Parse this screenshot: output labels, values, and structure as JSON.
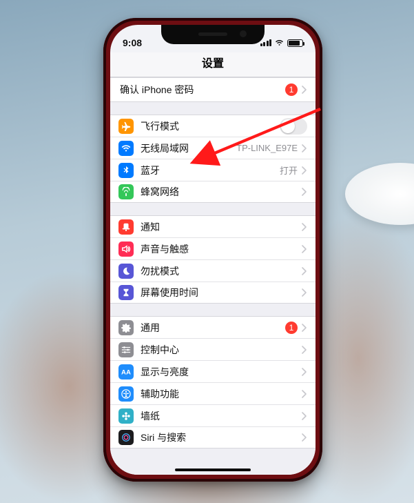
{
  "status": {
    "time": "9:08"
  },
  "title": "设置",
  "groups": [
    {
      "id": "account",
      "cells": [
        {
          "id": "confirm-password",
          "label": "确认 iPhone 密码",
          "badge": "1",
          "chevron": true,
          "icon": null
        }
      ]
    },
    {
      "id": "network",
      "cells": [
        {
          "id": "airplane",
          "label": "飞行模式",
          "icon": "airplane-icon",
          "bg": "bg-orange",
          "toggle": false
        },
        {
          "id": "wifi",
          "label": "无线局域网",
          "value": "TP-LINK_E97E",
          "icon": "wifi-icon",
          "bg": "bg-blue",
          "chevron": true
        },
        {
          "id": "bluetooth",
          "label": "蓝牙",
          "value": "打开",
          "icon": "bluetooth-icon",
          "bg": "bg-blue",
          "chevron": true
        },
        {
          "id": "cellular",
          "label": "蜂窝网络",
          "icon": "cellular-icon",
          "bg": "bg-green",
          "chevron": true
        }
      ]
    },
    {
      "id": "alerts",
      "cells": [
        {
          "id": "notifications",
          "label": "通知",
          "icon": "bell-icon",
          "bg": "bg-red",
          "chevron": true
        },
        {
          "id": "sounds",
          "label": "声音与触感",
          "icon": "speaker-icon",
          "bg": "bg-pink",
          "chevron": true
        },
        {
          "id": "dnd",
          "label": "勿扰模式",
          "icon": "moon-icon",
          "bg": "bg-purple",
          "chevron": true
        },
        {
          "id": "screentime",
          "label": "屏幕使用时间",
          "icon": "hourglass-icon",
          "bg": "bg-purple",
          "chevron": true
        }
      ]
    },
    {
      "id": "general",
      "cells": [
        {
          "id": "general",
          "label": "通用",
          "icon": "gear-icon",
          "bg": "bg-grey",
          "badge": "1",
          "chevron": true
        },
        {
          "id": "control-center",
          "label": "控制中心",
          "icon": "sliders-icon",
          "bg": "bg-grey",
          "chevron": true
        },
        {
          "id": "display",
          "label": "显示与亮度",
          "icon": "aa-icon",
          "bg": "bg-blue2",
          "chevron": true
        },
        {
          "id": "accessibility",
          "label": "辅助功能",
          "icon": "accessibility-icon",
          "bg": "bg-blue2",
          "chevron": true
        },
        {
          "id": "wallpaper",
          "label": "墙纸",
          "icon": "flower-icon",
          "bg": "bg-teal",
          "chevron": true
        },
        {
          "id": "siri",
          "label": "Siri 与搜索",
          "icon": "siri-icon",
          "bg": "bg-dark",
          "chevron": true
        }
      ]
    }
  ],
  "annotation": {
    "target": "wifi"
  }
}
